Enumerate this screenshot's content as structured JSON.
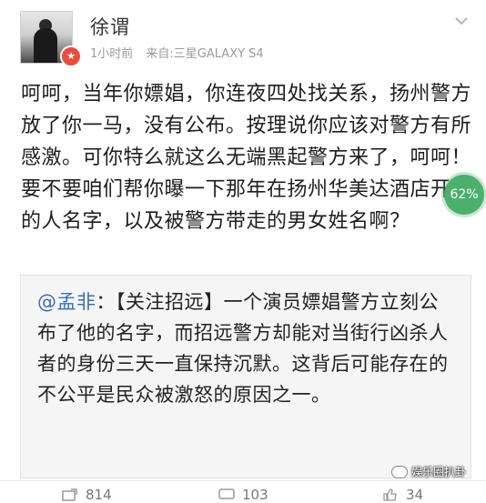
{
  "user": {
    "name": "徐谓",
    "time": "1小时前",
    "source": "来自:三星GALAXY S4",
    "badge_icon": "verified-badge-icon"
  },
  "post": {
    "text": "呵呵，当年你嫖娼，你连夜四处找关系，扬州警方放了你一马，没有公布。按理说你应该对警方有所感激。可你特么就这么无端黑起警方来了，呵呵！要不要咱们帮你曝一下那年在扬州华美达酒店开房的人名字，以及被警方带走的男女姓名啊？"
  },
  "overlay": {
    "percent": "62%"
  },
  "repost": {
    "mention": "@孟非",
    "text": "：【关注招远】一个演员嫖娼警方立刻公布了他的名字，而招远警方却能对当街行凶杀人者的身份三天一直保持沉默。这背后可能存在的不公平是民众被激怒的原因之一。"
  },
  "stats": {
    "reposts": "814",
    "comments": "103",
    "likes": "34"
  },
  "watermark": {
    "text": "娱乐圈扒卦"
  },
  "colors": {
    "mention": "#3a6fb4",
    "badge": "#e74c3c",
    "percent_bg": "#4caf6e"
  }
}
